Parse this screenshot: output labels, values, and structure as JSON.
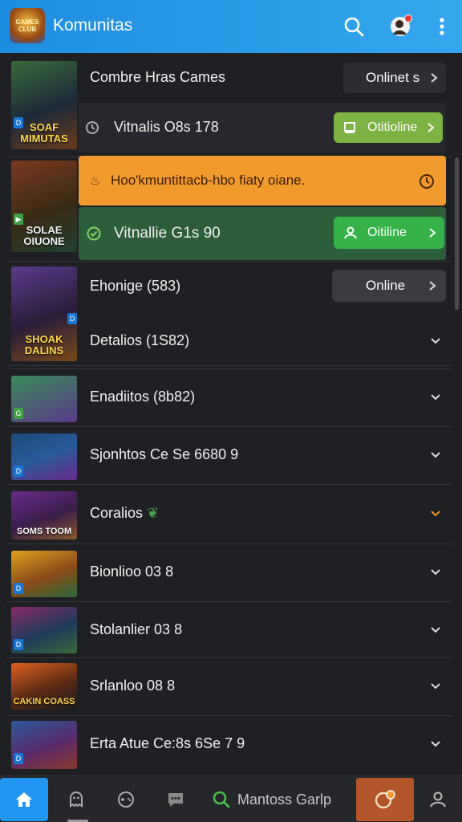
{
  "app": {
    "title": "Komunitas",
    "logo_text": "GAMES CLUB"
  },
  "list": {
    "rows": [
      {
        "title": "Combre Hras Cames",
        "thumb_caption": "SOAF MIMUTAS",
        "pill_label": "Onlinet s"
      },
      {
        "sub_title": "Vitnalis O8s 178",
        "sub_pill": "Otitioline"
      },
      {
        "banner_text": "Hoo'kmuntittacb-hbo fiaty oiane.",
        "thumb_caption": "SOLAE OIUONE"
      },
      {
        "sub_title": "Vitnallie G1s 90",
        "sub_pill": "Oitiline"
      },
      {
        "title": "Ehonige (583)",
        "thumb_caption": "SHOAK DALINS",
        "pill_label": "Online"
      },
      {
        "title": "Detalios (1S82)"
      },
      {
        "title": "Enadiitos (8b82)"
      },
      {
        "title": "Sjonhtos Ce Se 6680 9"
      },
      {
        "title": "Coralios",
        "thumb_caption": "SOMS TOOM"
      },
      {
        "title": "Bionlioo 03 8"
      },
      {
        "title": "Stolanlier 03 8"
      },
      {
        "title": "Srlanloo 08 8"
      },
      {
        "title": "Erta Atue Ce:8s 6Se 7 9",
        "thumb_caption": ""
      }
    ],
    "row12_caption": "CAKIN COASS"
  },
  "bottom": {
    "search_label": "Mantoss Garlp"
  },
  "colors": {
    "accent": "#2196f3",
    "green": "#7cb342",
    "orange": "#f39a2f",
    "dark_green": "#2c5e3a"
  }
}
